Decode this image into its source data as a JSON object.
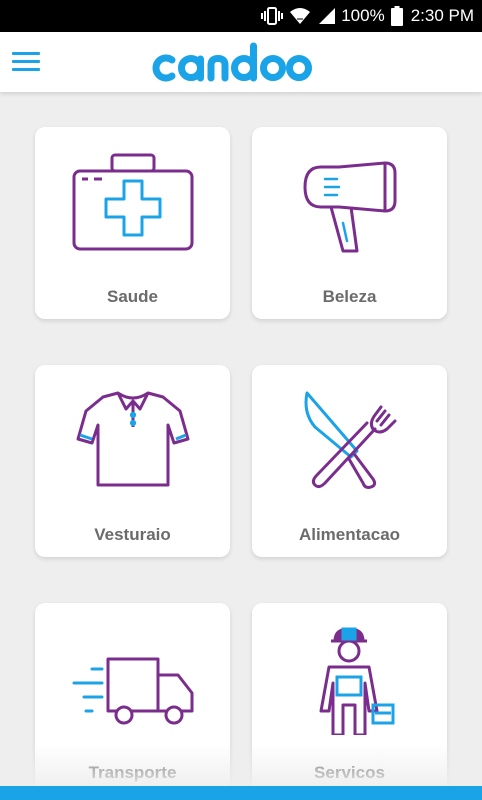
{
  "status": {
    "battery_percent": "100%",
    "time": "2:30 PM",
    "icons": [
      "vibrate-icon",
      "wifi-icon",
      "signal-icon",
      "battery-icon"
    ]
  },
  "header": {
    "app_name": "candoo",
    "menu_icon": "hamburger-menu-icon"
  },
  "colors": {
    "brand_blue": "#1ba3e8",
    "icon_purple": "#7b2d8e",
    "background": "#efeeee",
    "label_gray": "#6b6b6b"
  },
  "categories": [
    {
      "label": "Saude",
      "icon": "first-aid-kit-icon"
    },
    {
      "label": "Beleza",
      "icon": "hair-dryer-icon"
    },
    {
      "label": "Vesturaio",
      "icon": "polo-shirt-icon"
    },
    {
      "label": "Alimentacao",
      "icon": "knife-fork-icon"
    },
    {
      "label": "Transporte",
      "icon": "delivery-truck-icon"
    },
    {
      "label": "Servicos",
      "icon": "worker-icon"
    }
  ]
}
